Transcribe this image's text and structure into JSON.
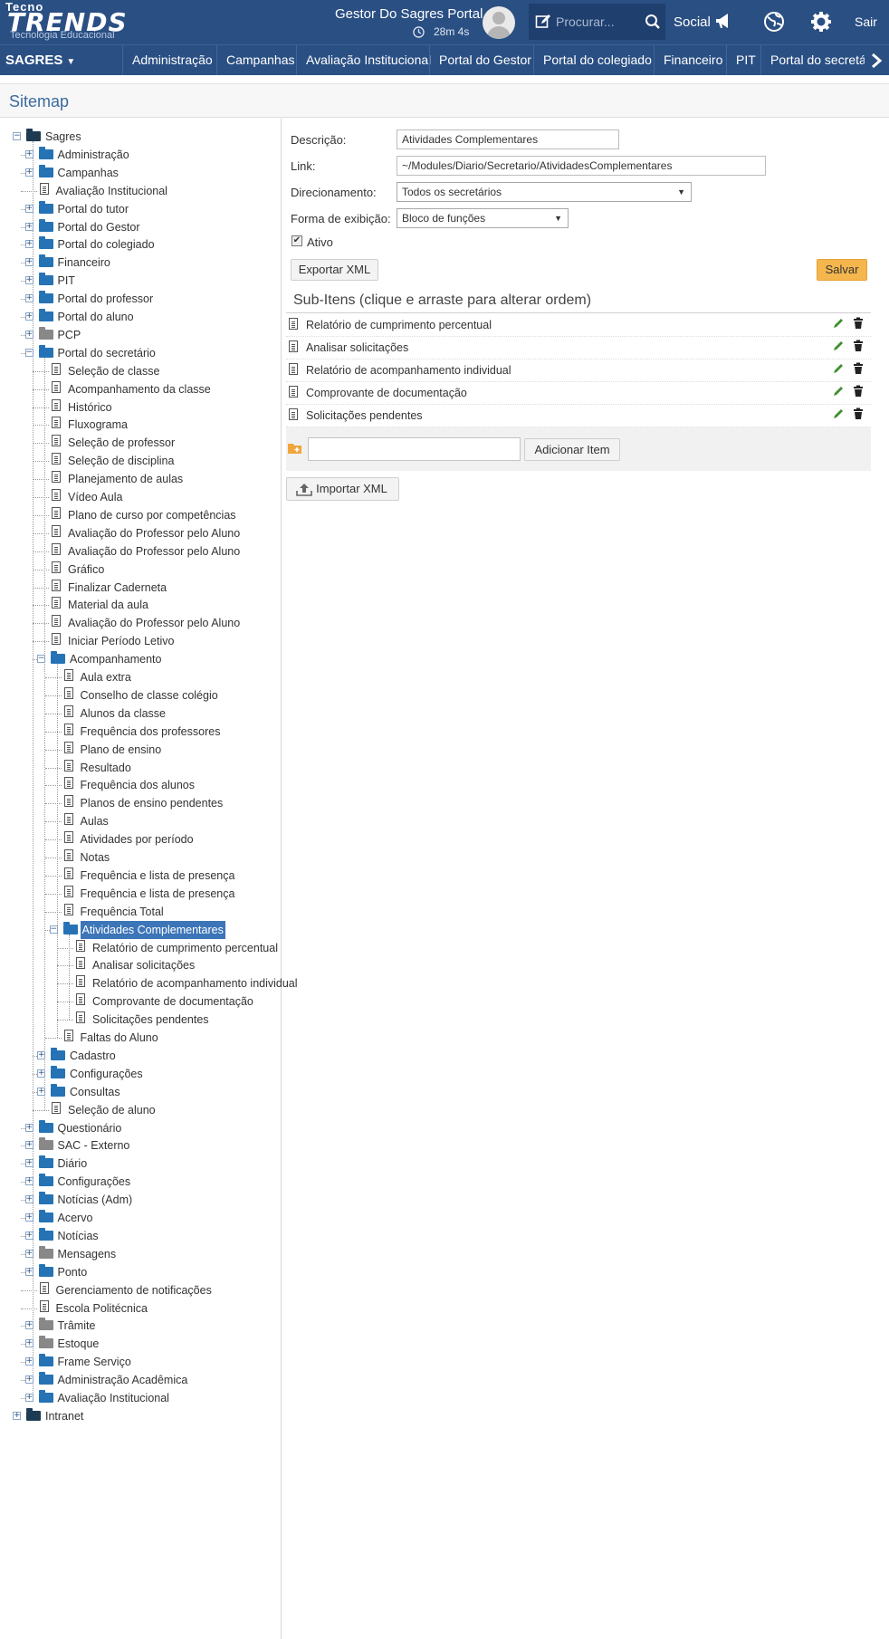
{
  "header": {
    "logo_top": "Tecno",
    "logo_main": "TRENDS",
    "logo_sub": "Tecnologia Educacional",
    "portal_title": "Gestor Do Sagres Portal",
    "timer": "28m 4s",
    "search_placeholder": "Procurar...",
    "social_label": "Social",
    "logout_label": "Sair"
  },
  "nav": {
    "brand": "SAGRES",
    "items": [
      "Administração",
      "Campanhas",
      "Avaliação Institucional",
      "Portal do Gestor",
      "Portal do colegiado",
      "Financeiro",
      "PIT",
      "Portal do secretá"
    ]
  },
  "page_title": "Sitemap",
  "tree": [
    {
      "label": "Sagres",
      "level": 0,
      "type": "folder",
      "expander": "minus",
      "color": "#1d3b52"
    },
    {
      "label": "Administração",
      "level": 1,
      "type": "folder",
      "expander": "plus",
      "color": "#2573b5"
    },
    {
      "label": "Campanhas",
      "level": 1,
      "type": "folder",
      "expander": "plus",
      "color": "#2573b5"
    },
    {
      "label": "Avaliação Institucional",
      "level": 1,
      "type": "page"
    },
    {
      "label": "Portal do tutor",
      "level": 1,
      "type": "folder",
      "expander": "plus",
      "color": "#2573b5"
    },
    {
      "label": "Portal do Gestor",
      "level": 1,
      "type": "folder",
      "expander": "plus",
      "color": "#2573b5"
    },
    {
      "label": "Portal do colegiado",
      "level": 1,
      "type": "folder",
      "expander": "plus",
      "color": "#2573b5"
    },
    {
      "label": "Financeiro",
      "level": 1,
      "type": "folder",
      "expander": "plus",
      "color": "#2573b5"
    },
    {
      "label": "PIT",
      "level": 1,
      "type": "folder",
      "expander": "plus",
      "color": "#2573b5"
    },
    {
      "label": "Portal do professor",
      "level": 1,
      "type": "folder",
      "expander": "plus",
      "color": "#2573b5"
    },
    {
      "label": "Portal do aluno",
      "level": 1,
      "type": "folder",
      "expander": "plus",
      "color": "#2573b5"
    },
    {
      "label": "PCP",
      "level": 1,
      "type": "folder",
      "expander": "plus",
      "color": "#888888"
    },
    {
      "label": "Portal do secretário",
      "level": 1,
      "type": "folder",
      "expander": "minus",
      "color": "#2573b5"
    },
    {
      "label": "Seleção de classe",
      "level": 2,
      "type": "page"
    },
    {
      "label": "Acompanhamento da classe",
      "level": 2,
      "type": "page"
    },
    {
      "label": "Histórico",
      "level": 2,
      "type": "page"
    },
    {
      "label": "Fluxograma",
      "level": 2,
      "type": "page"
    },
    {
      "label": "Seleção de professor",
      "level": 2,
      "type": "page"
    },
    {
      "label": "Seleção de disciplina",
      "level": 2,
      "type": "page"
    },
    {
      "label": "Planejamento de aulas",
      "level": 2,
      "type": "page"
    },
    {
      "label": "Vídeo Aula",
      "level": 2,
      "type": "page"
    },
    {
      "label": "Plano de curso por competências",
      "level": 2,
      "type": "page"
    },
    {
      "label": "Avaliação do Professor pelo Aluno",
      "level": 2,
      "type": "page"
    },
    {
      "label": "Avaliação do Professor pelo Aluno",
      "level": 2,
      "type": "page"
    },
    {
      "label": "Gráfico",
      "level": 2,
      "type": "page"
    },
    {
      "label": "Finalizar Caderneta",
      "level": 2,
      "type": "page"
    },
    {
      "label": "Material da aula",
      "level": 2,
      "type": "page"
    },
    {
      "label": "Avaliação do Professor pelo Aluno",
      "level": 2,
      "type": "page"
    },
    {
      "label": "Iniciar Período Letivo",
      "level": 2,
      "type": "page"
    },
    {
      "label": "Acompanhamento",
      "level": 2,
      "type": "folder",
      "expander": "minus",
      "color": "#2573b5"
    },
    {
      "label": "Aula extra",
      "level": 3,
      "type": "page"
    },
    {
      "label": "Conselho de classe colégio",
      "level": 3,
      "type": "page"
    },
    {
      "label": "Alunos da classe",
      "level": 3,
      "type": "page"
    },
    {
      "label": "Frequência dos professores",
      "level": 3,
      "type": "page"
    },
    {
      "label": "Plano de ensino",
      "level": 3,
      "type": "page"
    },
    {
      "label": "Resultado",
      "level": 3,
      "type": "page"
    },
    {
      "label": "Frequência dos alunos",
      "level": 3,
      "type": "page"
    },
    {
      "label": "Planos de ensino pendentes",
      "level": 3,
      "type": "page"
    },
    {
      "label": "Aulas",
      "level": 3,
      "type": "page"
    },
    {
      "label": "Atividades por período",
      "level": 3,
      "type": "page"
    },
    {
      "label": "Notas",
      "level": 3,
      "type": "page"
    },
    {
      "label": "Frequência e lista de presença",
      "level": 3,
      "type": "page"
    },
    {
      "label": "Frequência e lista de presença",
      "level": 3,
      "type": "page"
    },
    {
      "label": "Frequência Total",
      "level": 3,
      "type": "page"
    },
    {
      "label": "Atividades Complementares",
      "level": 3,
      "type": "folder",
      "expander": "minus",
      "color": "#2573b5",
      "selected": true
    },
    {
      "label": "Relatório de cumprimento percentual",
      "level": 4,
      "type": "page"
    },
    {
      "label": "Analisar solicitações",
      "level": 4,
      "type": "page"
    },
    {
      "label": "Relatório de acompanhamento individual",
      "level": 4,
      "type": "page"
    },
    {
      "label": "Comprovante de documentação",
      "level": 4,
      "type": "page"
    },
    {
      "label": "Solicitações pendentes",
      "level": 4,
      "type": "page"
    },
    {
      "label": "Faltas do Aluno",
      "level": 3,
      "type": "page"
    },
    {
      "label": "Cadastro",
      "level": 2,
      "type": "folder",
      "expander": "plus",
      "color": "#2573b5"
    },
    {
      "label": "Configurações",
      "level": 2,
      "type": "folder",
      "expander": "plus",
      "color": "#2573b5"
    },
    {
      "label": "Consultas",
      "level": 2,
      "type": "folder",
      "expander": "plus",
      "color": "#2573b5"
    },
    {
      "label": "Seleção de aluno",
      "level": 2,
      "type": "page"
    },
    {
      "label": "Questionário",
      "level": 1,
      "type": "folder",
      "expander": "plus",
      "color": "#2573b5"
    },
    {
      "label": "SAC - Externo",
      "level": 1,
      "type": "folder",
      "expander": "plus",
      "color": "#888888"
    },
    {
      "label": "Diário",
      "level": 1,
      "type": "folder",
      "expander": "plus",
      "color": "#2573b5"
    },
    {
      "label": "Configurações",
      "level": 1,
      "type": "folder",
      "expander": "plus",
      "color": "#2573b5"
    },
    {
      "label": "Notícias (Adm)",
      "level": 1,
      "type": "folder",
      "expander": "plus",
      "color": "#2573b5"
    },
    {
      "label": "Acervo",
      "level": 1,
      "type": "folder",
      "expander": "plus",
      "color": "#2573b5"
    },
    {
      "label": "Notícias",
      "level": 1,
      "type": "folder",
      "expander": "plus",
      "color": "#2573b5"
    },
    {
      "label": "Mensagens",
      "level": 1,
      "type": "folder",
      "expander": "plus",
      "color": "#888888"
    },
    {
      "label": "Ponto",
      "level": 1,
      "type": "folder",
      "expander": "plus",
      "color": "#2573b5"
    },
    {
      "label": "Gerenciamento de notificações",
      "level": 1,
      "type": "page"
    },
    {
      "label": "Escola Politécnica",
      "level": 1,
      "type": "page"
    },
    {
      "label": "Trâmite",
      "level": 1,
      "type": "folder",
      "expander": "plus",
      "color": "#888888"
    },
    {
      "label": "Estoque",
      "level": 1,
      "type": "folder",
      "expander": "plus",
      "color": "#888888"
    },
    {
      "label": "Frame Serviço",
      "level": 1,
      "type": "folder",
      "expander": "plus",
      "color": "#2573b5"
    },
    {
      "label": "Administração Acadêmica",
      "level": 1,
      "type": "folder",
      "expander": "plus",
      "color": "#2573b5"
    },
    {
      "label": "Avaliação Institucional",
      "level": 1,
      "type": "folder",
      "expander": "plus",
      "color": "#2573b5"
    },
    {
      "label": "Intranet",
      "level": 0,
      "type": "folder",
      "expander": "plus",
      "color": "#1d3b52"
    }
  ],
  "form": {
    "descricao_label": "Descrição:",
    "descricao_value": "Atividades Complementares",
    "link_label": "Link:",
    "link_value": "~/Modules/Diario/Secretario/AtividadesComplementares",
    "direcionamento_label": "Direcionamento:",
    "direcionamento_value": "Todos os secretários",
    "forma_label": "Forma de exibição:",
    "forma_value": "Bloco de funções",
    "ativo_label": "Ativo",
    "ativo_checked": true,
    "export_label": "Exportar XML",
    "save_label": "Salvar"
  },
  "subitems": {
    "title": "Sub-Itens (clique e arraste para alterar ordem)",
    "items": [
      "Relatório de cumprimento percentual",
      "Analisar solicitações",
      "Relatório de acompanhamento individual",
      "Comprovante de documentação",
      "Solicitações pendentes"
    ],
    "add_input_value": "",
    "add_label": "Adicionar Item",
    "import_label": "Importar XML"
  },
  "colors": {
    "header_bg": "#2a4f83",
    "accent": "#3c75b8",
    "save_button": "#f5b64e",
    "folder_blue": "#2573b5",
    "folder_gray": "#888888"
  }
}
